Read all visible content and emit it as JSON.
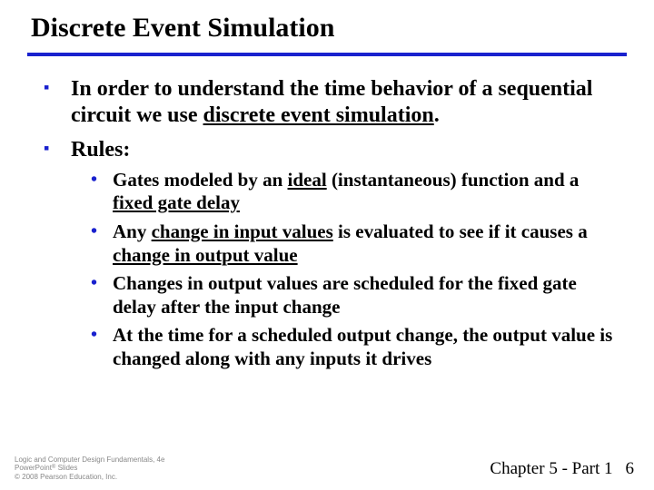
{
  "title": "Discrete Event Simulation",
  "bullets": {
    "b1_pre": "In order to understand the time behavior of a sequential circuit we use ",
    "b1_u": "discrete event simulation",
    "b1_post": ".",
    "b2": "Rules:"
  },
  "sub": {
    "s1_pre": "Gates modeled by an ",
    "s1_u1": "ideal",
    "s1_mid": " (instantaneous) function and a ",
    "s1_u2": "fixed gate delay",
    "s2_pre": "Any ",
    "s2_u1": "change in input values",
    "s2_mid": " is evaluated to see if it causes a ",
    "s2_u2": "change in output value",
    "s3": "Changes in output values are scheduled for the fixed gate delay after the input change",
    "s4": "At the time for a scheduled output change, the output value is changed along with any inputs it drives"
  },
  "footer": {
    "line1": "Logic and Computer Design Fundamentals, 4e",
    "line2a": "PowerPoint",
    "line2sup": "®",
    "line2b": " Slides",
    "line3": "© 2008 Pearson Education, Inc.",
    "chapter": "Chapter 5 - Part 1",
    "page": "6"
  }
}
